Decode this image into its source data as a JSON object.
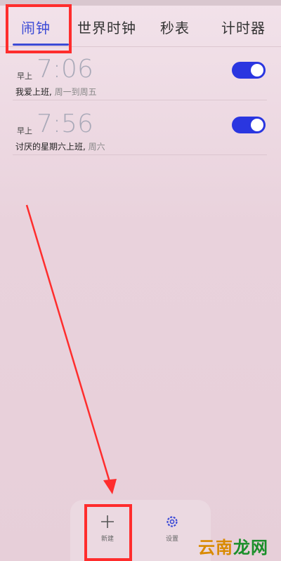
{
  "tabs": [
    {
      "label": "闹钟"
    },
    {
      "label": "世界时钟"
    },
    {
      "label": "秒表"
    },
    {
      "label": "计时器"
    }
  ],
  "alarms": [
    {
      "period": "早上",
      "time": "7:06",
      "label": "我爱上班",
      "days": "周一到周五",
      "enabled": true
    },
    {
      "period": "早上",
      "time": "7:56",
      "label": "讨厌的星期六上班",
      "days": "周六",
      "enabled": true
    }
  ],
  "bottom": {
    "add_label": "新建",
    "settings_label": "设置"
  },
  "watermark": {
    "part1": "云南",
    "part2": "龙网"
  },
  "colors": {
    "accent": "#3c4bd6",
    "toggle_on": "#2a36e0",
    "annotation": "#ff2d2d",
    "background": "#ead8e0"
  },
  "icons": {
    "add": "plus-icon",
    "settings": "gear-icon"
  }
}
